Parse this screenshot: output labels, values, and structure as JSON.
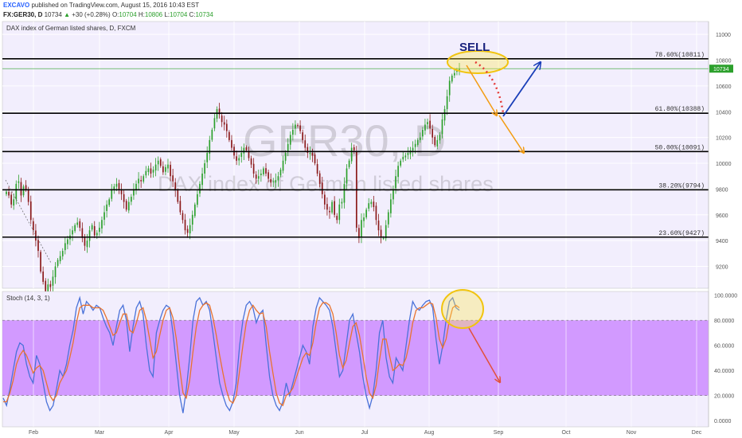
{
  "header": {
    "publisher": "EXCAVO",
    "published_text": "published on TradingView.com, August 15, 2016 10:43 EST",
    "symbol": "FX:GER30, D",
    "last": "10734",
    "change": "+30 (+0.28%)",
    "o_label": "O:",
    "o": "10704",
    "h_label": "H:",
    "h": "10806",
    "l_label": "L:",
    "l": "10704",
    "c_label": "C:",
    "c": "10734"
  },
  "chart_data": [
    {
      "type": "candlestick",
      "title": "DAX index of German listed shares, D, FXCM",
      "watermark_symbol": "GER30, D",
      "watermark_desc": "DAX index of German listed shares",
      "annotation": "SELL",
      "x_ticks": [
        "Feb",
        "Mar",
        "Apr",
        "May",
        "Jun",
        "Jul",
        "Aug",
        "Sep",
        "Oct",
        "Nov",
        "Dec"
      ],
      "y_ticks": [
        9200,
        9400,
        9600,
        9800,
        10000,
        10200,
        10400,
        10600,
        10800,
        11000
      ],
      "ylim": [
        9030,
        11100
      ],
      "last_price_label": "10734",
      "fib_levels": [
        {
          "label": "78.60%(10811)",
          "value": 10811
        },
        {
          "label": "61.80%(10388)",
          "value": 10388
        },
        {
          "label": "50.00%(10091)",
          "value": 10091
        },
        {
          "label": "38.20%(9794)",
          "value": 9794
        },
        {
          "label": "23.60%(9427)",
          "value": 9427
        }
      ],
      "colors": {
        "up": "#2ca02c",
        "down": "#8b1a1a",
        "fib": "#000000",
        "last": "#2ca02c"
      },
      "candle_closes": [
        9780,
        9750,
        9680,
        9720,
        9840,
        9860,
        9750,
        9820,
        9800,
        9700,
        9560,
        9480,
        9400,
        9320,
        9160,
        9080,
        9000,
        9060,
        9040,
        9120,
        9200,
        9250,
        9280,
        9320,
        9380,
        9410,
        9440,
        9480,
        9520,
        9540,
        9500,
        9420,
        9360,
        9400,
        9480,
        9520,
        9440,
        9460,
        9500,
        9560,
        9620,
        9680,
        9720,
        9800,
        9820,
        9840,
        9800,
        9760,
        9700,
        9640,
        9700,
        9740,
        9800,
        9840,
        9880,
        9860,
        9900,
        9940,
        9960,
        9920,
        9950,
        9990,
        10020,
        9980,
        9930,
        9970,
        9990,
        9900,
        9860,
        9790,
        9700,
        9620,
        9560,
        9480,
        9460,
        9520,
        9600,
        9680,
        9760,
        9840,
        9920,
        10000,
        10080,
        10180,
        10260,
        10350,
        10420,
        10380,
        10320,
        10300,
        10250,
        10180,
        10120,
        10060,
        10020,
        10040,
        10080,
        10120,
        10100,
        10040,
        9990,
        9920,
        9880,
        9900,
        9920,
        9960,
        9920,
        9880,
        9850,
        9860,
        9870,
        9900,
        9950,
        10020,
        10080,
        10150,
        10220,
        10260,
        10300,
        10290,
        10250,
        10180,
        10120,
        10080,
        10080,
        10060,
        10000,
        9920,
        9840,
        9760,
        9680,
        9640,
        9620,
        9700,
        9600,
        9560,
        9680,
        9700,
        9840,
        9960,
        10020,
        10120,
        10100,
        9500,
        9420,
        9560,
        9580,
        9640,
        9690,
        9700,
        9660,
        9560,
        9480,
        9430,
        9420,
        9520,
        9620,
        9720,
        9800,
        9900,
        9980,
        10020,
        10050,
        10060,
        10080,
        10100,
        10120,
        10150,
        10180,
        10200,
        10260,
        10300,
        10320,
        10270,
        10200,
        10140,
        10180,
        10220,
        10340,
        10420,
        10520,
        10640,
        10680,
        10700,
        10720,
        10734
      ]
    },
    {
      "type": "line",
      "title": "Stoch (14, 3, 1)",
      "x_ticks": [
        "Feb",
        "Mar",
        "Apr",
        "May",
        "Jun",
        "Jul",
        "Aug",
        "Sep",
        "Oct",
        "Nov",
        "Dec"
      ],
      "y_ticks": [
        0,
        20,
        40,
        60,
        80,
        100
      ],
      "y_tick_labels": [
        "0.0000",
        "20.0000",
        "40.0000",
        "60.0000",
        "80.0000",
        "100.0000"
      ],
      "ylim": [
        -5,
        103
      ],
      "band": [
        20,
        80
      ],
      "series": [
        {
          "color": "#4a72d9",
          "values": [
            18,
            12,
            25,
            40,
            55,
            62,
            60,
            45,
            35,
            30,
            52,
            45,
            30,
            15,
            8,
            12,
            25,
            40,
            35,
            45,
            60,
            72,
            90,
            98,
            85,
            95,
            92,
            88,
            92,
            90,
            82,
            75,
            70,
            60,
            75,
            88,
            92,
            80,
            55,
            75,
            90,
            95,
            85,
            60,
            40,
            35,
            70,
            80,
            88,
            92,
            90,
            70,
            45,
            20,
            6,
            25,
            50,
            80,
            95,
            98,
            92,
            95,
            88,
            70,
            50,
            30,
            20,
            12,
            8,
            15,
            30,
            60,
            80,
            92,
            95,
            90,
            78,
            85,
            88,
            60,
            35,
            20,
            12,
            8,
            15,
            30,
            20,
            30,
            40,
            50,
            60,
            55,
            45,
            75,
            90,
            98,
            95,
            92,
            88,
            75,
            55,
            35,
            40,
            60,
            80,
            85,
            70,
            55,
            35,
            20,
            10,
            20,
            40,
            70,
            80,
            50,
            35,
            30,
            50,
            45,
            40,
            60,
            80,
            95,
            90,
            88,
            92,
            95,
            96,
            90,
            65,
            45,
            60,
            80,
            95,
            98,
            90,
            88
          ]
        },
        {
          "color": "#e8732f",
          "values": [
            15,
            15,
            22,
            32,
            45,
            52,
            56,
            52,
            45,
            38,
            42,
            44,
            40,
            30,
            20,
            16,
            20,
            30,
            35,
            40,
            50,
            62,
            78,
            90,
            92,
            92,
            92,
            90,
            90,
            90,
            88,
            82,
            75,
            68,
            70,
            78,
            85,
            85,
            72,
            70,
            78,
            88,
            90,
            80,
            65,
            50,
            55,
            68,
            80,
            88,
            90,
            82,
            65,
            42,
            22,
            18,
            32,
            55,
            75,
            88,
            92,
            94,
            92,
            82,
            68,
            52,
            38,
            25,
            16,
            14,
            20,
            40,
            60,
            78,
            88,
            92,
            88,
            85,
            86,
            75,
            55,
            38,
            22,
            14,
            12,
            20,
            22,
            26,
            34,
            42,
            50,
            54,
            52,
            62,
            78,
            90,
            94,
            94,
            92,
            85,
            70,
            52,
            42,
            48,
            62,
            75,
            78,
            68,
            52,
            35,
            22,
            18,
            28,
            48,
            65,
            65,
            52,
            40,
            42,
            45,
            44,
            50,
            62,
            78,
            88,
            90,
            90,
            92,
            94,
            93,
            82,
            65,
            58,
            65,
            80,
            90,
            92,
            90
          ]
        }
      ]
    }
  ]
}
